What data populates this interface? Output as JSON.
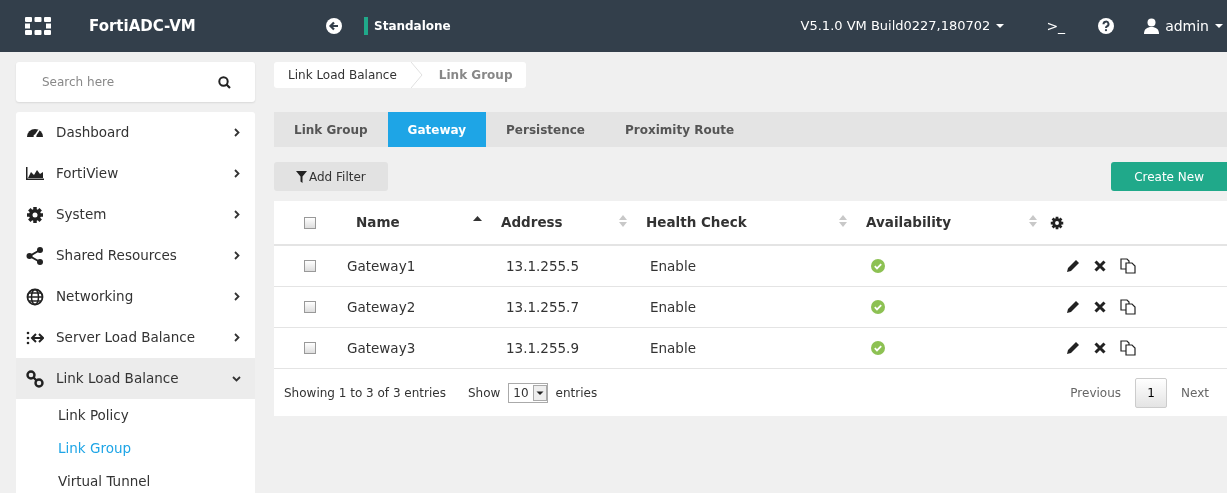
{
  "topbar": {
    "product": "FortiADC-VM",
    "mode": "Standalone",
    "version": "V5.1.0 VM Build0227,180702",
    "terminal": ">_",
    "user": "admin"
  },
  "search": {
    "placeholder": "Search here"
  },
  "breadcrumb": [
    "Link Load Balance",
    "Link Group"
  ],
  "sidebar": {
    "items": [
      {
        "label": "Dashboard",
        "expanded": false,
        "selected": false
      },
      {
        "label": "FortiView",
        "expanded": false,
        "selected": false
      },
      {
        "label": "System",
        "expanded": false,
        "selected": false
      },
      {
        "label": "Shared Resources",
        "expanded": false,
        "selected": false
      },
      {
        "label": "Networking",
        "expanded": false,
        "selected": false
      },
      {
        "label": "Server Load Balance",
        "expanded": false,
        "selected": false
      },
      {
        "label": "Link Load Balance",
        "expanded": true,
        "selected": true,
        "children": [
          {
            "label": "Link Policy",
            "selected": false
          },
          {
            "label": "Link Group",
            "selected": true
          },
          {
            "label": "Virtual Tunnel",
            "selected": false
          }
        ]
      }
    ]
  },
  "tabs": [
    {
      "label": "Link Group",
      "selected": false
    },
    {
      "label": "Gateway",
      "selected": true
    },
    {
      "label": "Persistence",
      "selected": false
    },
    {
      "label": "Proximity Route",
      "selected": false
    }
  ],
  "toolbar": {
    "filter": "Add Filter",
    "create": "Create New"
  },
  "table": {
    "columns": [
      {
        "kind": "checkbox",
        "checked": false
      },
      {
        "kind": "text",
        "label": "Name",
        "sorted": true
      },
      {
        "kind": "text",
        "label": "Address",
        "sorted": false
      },
      {
        "kind": "text",
        "label": "Health Check",
        "sorted": false
      },
      {
        "kind": "text",
        "label": "Availability",
        "sorted": false
      },
      {
        "kind": "settings"
      }
    ],
    "rows": [
      {
        "checked": false,
        "name": "Gateway1",
        "address": "13.1.255.5",
        "health_check": "Enable",
        "available": true
      },
      {
        "checked": false,
        "name": "Gateway2",
        "address": "13.1.255.7",
        "health_check": "Enable",
        "available": true
      },
      {
        "checked": false,
        "name": "Gateway3",
        "address": "13.1.255.9",
        "health_check": "Enable",
        "available": true
      }
    ]
  },
  "footer": {
    "info": "Showing 1 to 3 of 3 entries",
    "show": "Show",
    "page_size": "10",
    "entries": "entries",
    "previous": "Previous",
    "page": "1",
    "next": "Next"
  }
}
